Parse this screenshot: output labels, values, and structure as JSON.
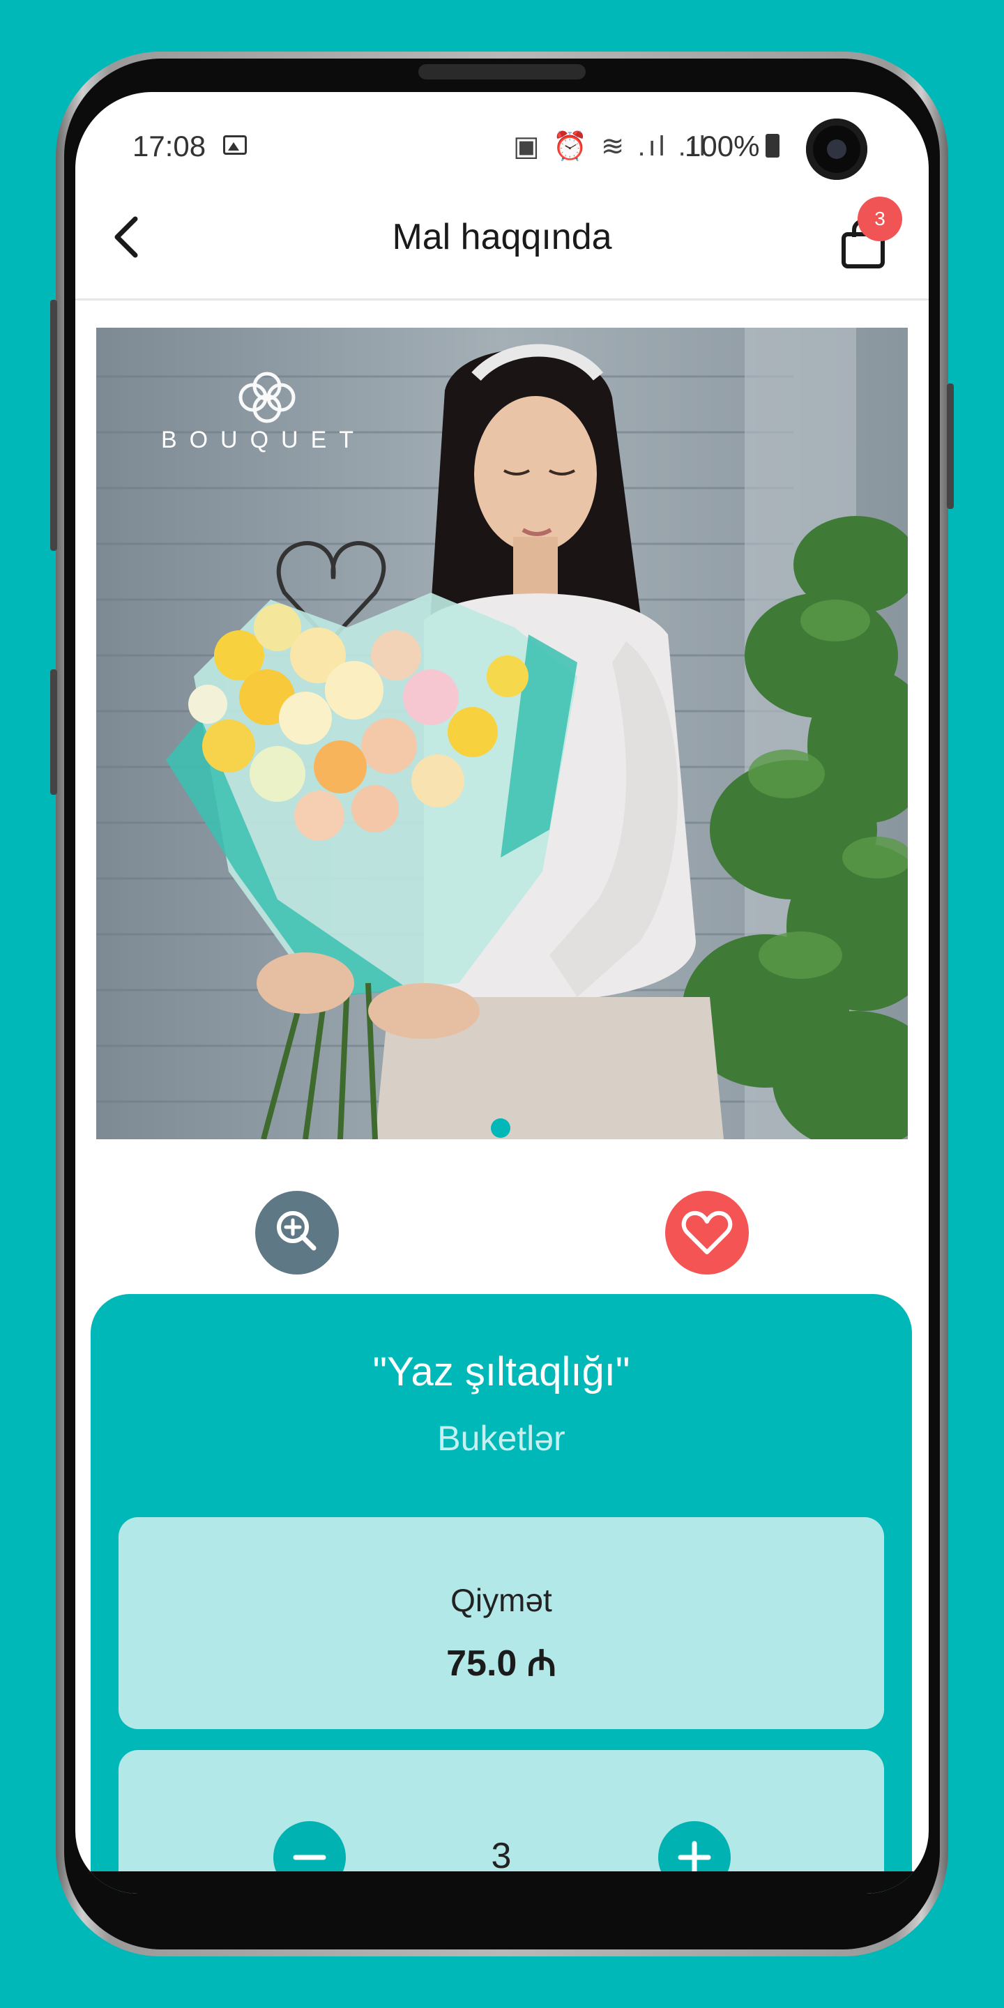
{
  "status_bar": {
    "time": "17:08",
    "status_icons": "▣ ⏰ ≋ .ıl .ıl",
    "battery": "100%"
  },
  "app_bar": {
    "title": "Mal haqqında",
    "cart_count": "3"
  },
  "photo": {
    "brand_mark": "BOUQUET"
  },
  "product": {
    "name": "\"Yaz şıltaqlığı\"",
    "category": "Buketlər",
    "price_label": "Qiymət",
    "price_value": "75.0 ₼",
    "quantity": "3"
  },
  "colors": {
    "accent": "#00b8b8",
    "favorite": "#f55454",
    "zoom": "#5f7886",
    "panel": "#b3e8e8"
  }
}
